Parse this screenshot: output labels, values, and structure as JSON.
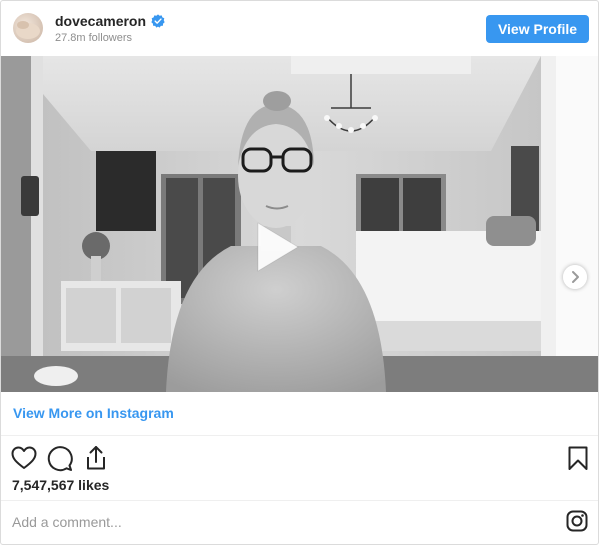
{
  "profile": {
    "username": "dovecameron",
    "followers": "27.8m followers",
    "view_profile_label": "View Profile",
    "verified": true,
    "accent_color": "#3897f0"
  },
  "media": {
    "type": "video",
    "play_icon": "play-icon",
    "next_icon": "chevron-right-icon"
  },
  "links": {
    "view_more": "View More on Instagram"
  },
  "actions": {
    "icons": [
      "heart-icon",
      "comment-icon",
      "share-icon",
      "bookmark-icon"
    ]
  },
  "likes": "7,547,567 likes",
  "comment": {
    "placeholder": "Add a comment..."
  },
  "footer": {
    "logo_icon": "instagram-logo-icon"
  }
}
